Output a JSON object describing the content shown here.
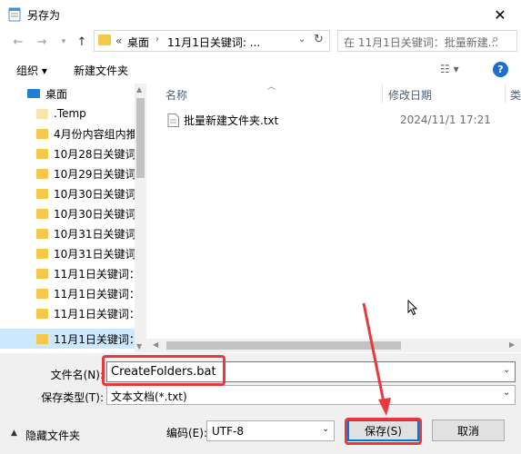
{
  "window": {
    "title": "另存为"
  },
  "address": {
    "separator": "«",
    "crumb1": "桌面",
    "crumb2": "11月1日关键词: ...",
    "search_placeholder": "在 11月1日关键词：批量新建..."
  },
  "toolbar": {
    "organize": "组织 ▾",
    "new_folder": "新建文件夹"
  },
  "sidebar": {
    "items": [
      {
        "label": "桌面"
      },
      {
        "label": ".Temp"
      },
      {
        "label": "4月份内容组内推"
      },
      {
        "label": "10月28日关键词："
      },
      {
        "label": "10月29日关键词："
      },
      {
        "label": "10月30日关键词："
      },
      {
        "label": "10月30日关键词："
      },
      {
        "label": "10月31日关键词："
      },
      {
        "label": "10月31日关键词："
      },
      {
        "label": "11月1日关键词："
      },
      {
        "label": "11月1日关键词："
      },
      {
        "label": "11月1日关键词："
      },
      {
        "label": "11月1日关键词："
      }
    ]
  },
  "columns": {
    "name": "名称",
    "modified": "修改日期",
    "type": "类"
  },
  "files": [
    {
      "name": "批量新建文件夹.txt",
      "modified": "2024/11/1 17:21"
    }
  ],
  "form": {
    "filename_label": "文件名(N):",
    "filename_value": "CreateFolders.bat",
    "filetype_label": "保存类型(T):",
    "filetype_value": "文本文档(*.txt)",
    "hide_folders": "隐藏文件夹",
    "encoding_label": "编码(E):",
    "encoding_value": "UTF-8",
    "save": "保存(S)",
    "cancel": "取消"
  },
  "colors": {
    "highlight": "#e8383d",
    "accent": "#0078d7",
    "selection": "#cce8ff"
  }
}
